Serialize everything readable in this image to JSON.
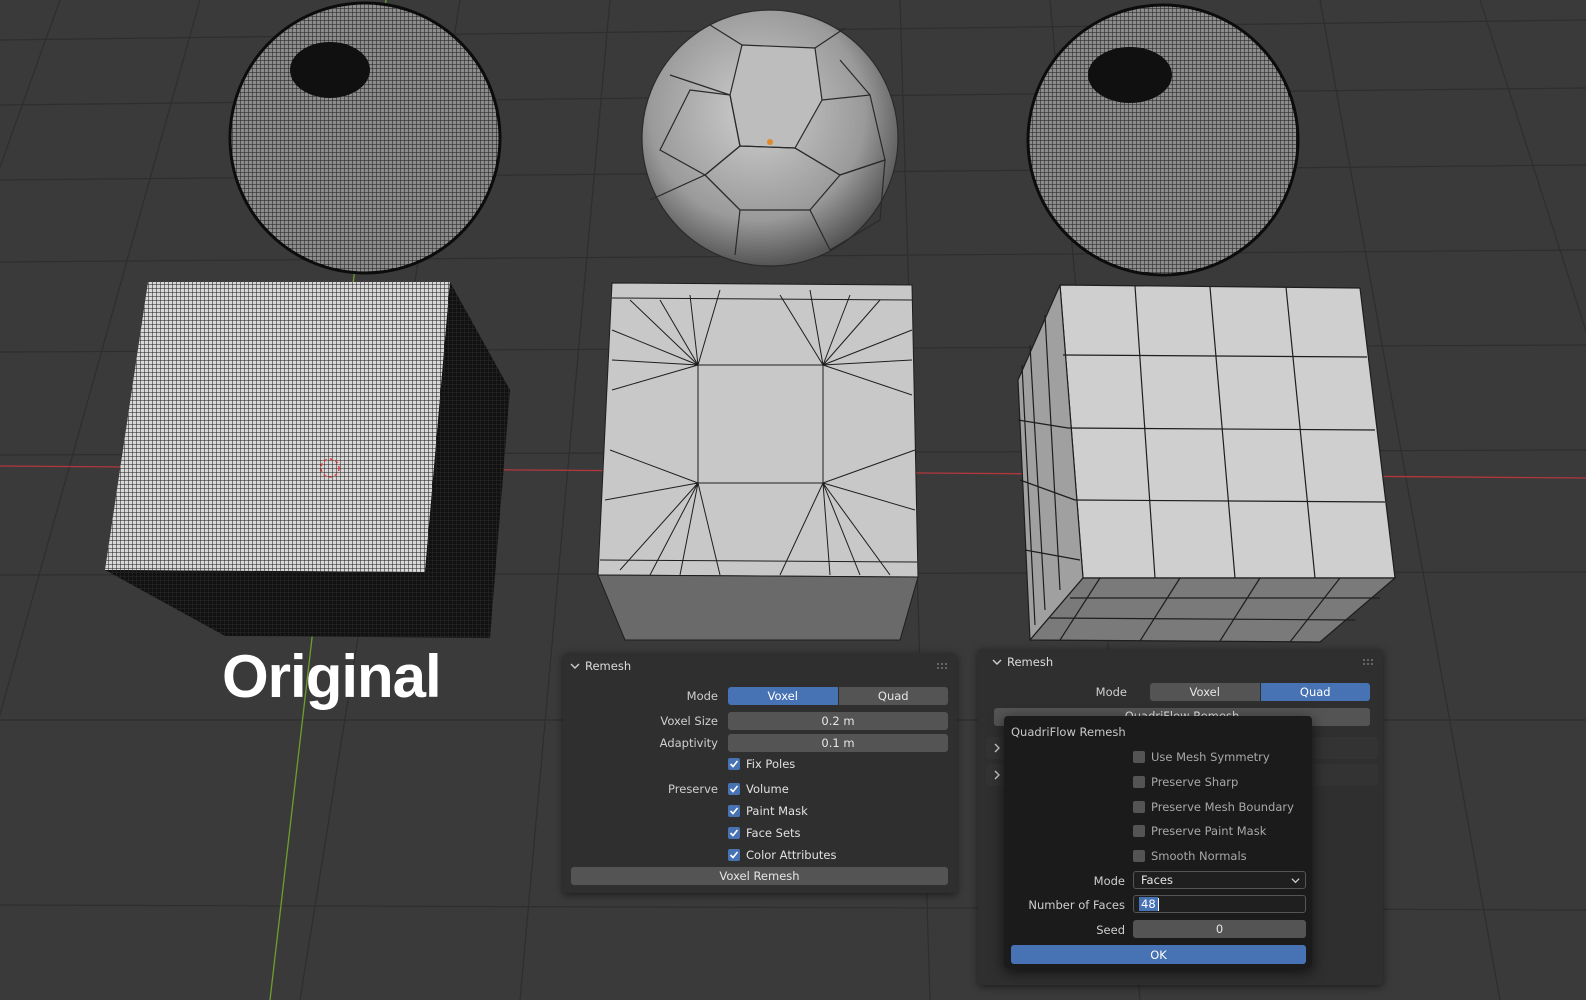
{
  "viewport": {
    "label": "Original"
  },
  "voxel_panel": {
    "title": "Remesh",
    "mode_label": "Mode",
    "mode_options": [
      "Voxel",
      "Quad"
    ],
    "mode_selected": "Voxel",
    "voxel_size_label": "Voxel Size",
    "voxel_size_value": "0.2 m",
    "adaptivity_label": "Adaptivity",
    "adaptivity_value": "0.1 m",
    "fix_poles": "Fix Poles",
    "preserve_label": "Preserve",
    "preserve_volume": "Volume",
    "preserve_paint_mask": "Paint Mask",
    "preserve_face_sets": "Face Sets",
    "preserve_color_attributes": "Color Attributes",
    "remesh_button": "Voxel Remesh"
  },
  "quad_panel": {
    "title": "Remesh",
    "mode_label": "Mode",
    "mode_options": [
      "Voxel",
      "Quad"
    ],
    "mode_selected": "Quad",
    "button_partial": "QuadriFlow Remesh"
  },
  "quadriflow_popup": {
    "title": "QuadriFlow Remesh",
    "use_mesh_symmetry": "Use Mesh Symmetry",
    "preserve_sharp": "Preserve Sharp",
    "preserve_mesh_boundary": "Preserve Mesh Boundary",
    "preserve_paint_mask": "Preserve Paint Mask",
    "smooth_normals": "Smooth Normals",
    "mode_label": "Mode",
    "mode_value": "Faces",
    "faces_label": "Number of Faces",
    "faces_value": "48",
    "seed_label": "Seed",
    "seed_value": "0",
    "ok_label": "OK"
  },
  "colors": {
    "accent": "#4772b3",
    "background": "#3a3a3a",
    "panel": "#2f2f2f",
    "popup": "#1b1b1b",
    "x_axis": "#c0392b",
    "y_axis": "#7bb33a"
  }
}
